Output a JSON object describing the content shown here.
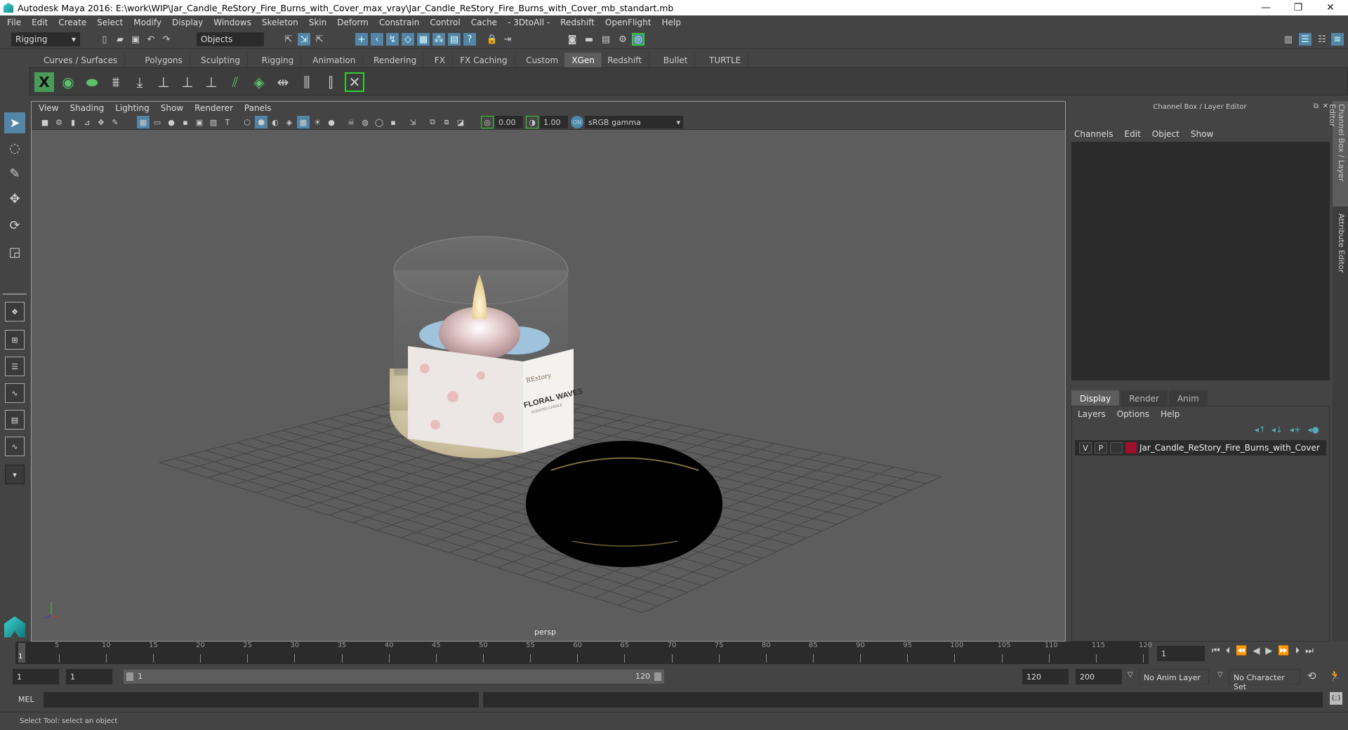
{
  "window": {
    "title": "Autodesk Maya 2016: E:\\work\\WIP\\Jar_Candle_ReStory_Fire_Burns_with_Cover_max_vray\\Jar_Candle_ReStory_Fire_Burns_with_Cover_mb_standart.mb",
    "minimize": "—",
    "restore": "❐",
    "close": "✕"
  },
  "menubar": [
    "File",
    "Edit",
    "Create",
    "Select",
    "Modify",
    "Display",
    "Windows",
    "Skeleton",
    "Skin",
    "Deform",
    "Constrain",
    "Control",
    "Cache",
    "- 3DtoAll -",
    "Redshift",
    "OpenFlight",
    "Help"
  ],
  "statusline": {
    "menuset": "Rigging",
    "selection_mask": "Objects"
  },
  "shelf_tabs": [
    {
      "label": "Curves / Surfaces"
    },
    {
      "label": "Polygons"
    },
    {
      "label": "Sculpting"
    },
    {
      "label": "Rigging"
    },
    {
      "label": "Animation"
    },
    {
      "label": "Rendering"
    },
    {
      "label": "FX"
    },
    {
      "label": "FX Caching"
    },
    {
      "label": "Custom"
    },
    {
      "label": "XGen",
      "active": true
    },
    {
      "label": "Redshift"
    },
    {
      "label": "Bullet"
    },
    {
      "label": "TURTLE"
    }
  ],
  "viewport": {
    "menu": [
      "View",
      "Shading",
      "Lighting",
      "Show",
      "Renderer",
      "Panels"
    ],
    "exposure": "0.00",
    "gamma": "1.00",
    "color_space": "sRGB gamma",
    "camera_label": "persp",
    "label_text": {
      "brand": "REstory",
      "title": "FLORAL WAVES",
      "subtitle": "SCENTED CANDLE"
    }
  },
  "channel_box": {
    "title": "Channel Box / Layer Editor",
    "menu": [
      "Channels",
      "Edit",
      "Object",
      "Show"
    ]
  },
  "layer_editor": {
    "tabs": [
      {
        "label": "Display",
        "active": true
      },
      {
        "label": "Render"
      },
      {
        "label": "Anim"
      }
    ],
    "menu": [
      "Layers",
      "Options",
      "Help"
    ],
    "layers": [
      {
        "v": "V",
        "p": "P",
        "color": "#a0102a",
        "name": "Jar_Candle_ReStory_Fire_Burns_with_Cover"
      }
    ]
  },
  "side_tabs": [
    "Channel Box / Layer Editor",
    "Attribute Editor"
  ],
  "timeline": {
    "ticks": [
      1,
      5,
      10,
      15,
      20,
      25,
      30,
      35,
      40,
      45,
      50,
      55,
      60,
      65,
      70,
      75,
      80,
      85,
      90,
      95,
      100,
      105,
      110,
      115,
      120
    ],
    "current_frame": "1"
  },
  "range": {
    "start": "1",
    "anim_start": "1",
    "slider_start": "1",
    "slider_end": "120",
    "end": "120",
    "anim_end": "200",
    "anim_layer": "No Anim Layer",
    "character_set": "No Character Set"
  },
  "command": {
    "lang": "MEL"
  },
  "help_line": "Select Tool: select an object"
}
